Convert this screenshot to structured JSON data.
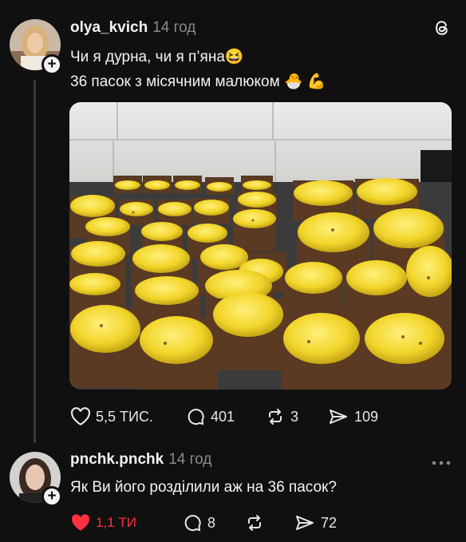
{
  "post": {
    "username": "olya_kvich",
    "time": "14 год",
    "line1": "Чи я дурна, чи я п’яна",
    "line2": "36 пасок з місячним малюком",
    "emoji1": "😆",
    "emoji2": "🐣 💪",
    "likes": "5,5 тис.",
    "comments": "401",
    "reposts": "3",
    "shares": "109"
  },
  "reply": {
    "username": "pnchk.pnchk",
    "time": "14 год",
    "text": "Як Ви його розділили аж на 36 пасок?",
    "likes": "1,1 ти",
    "comments": "8",
    "shares": "72"
  },
  "colors": {
    "background": "#101010",
    "like_active": "#ff3040",
    "muted": "#8a8a8a"
  },
  "icons": [
    "threads-logo-icon",
    "heart-icon",
    "comment-icon",
    "repost-icon",
    "share-icon",
    "more-icon"
  ]
}
